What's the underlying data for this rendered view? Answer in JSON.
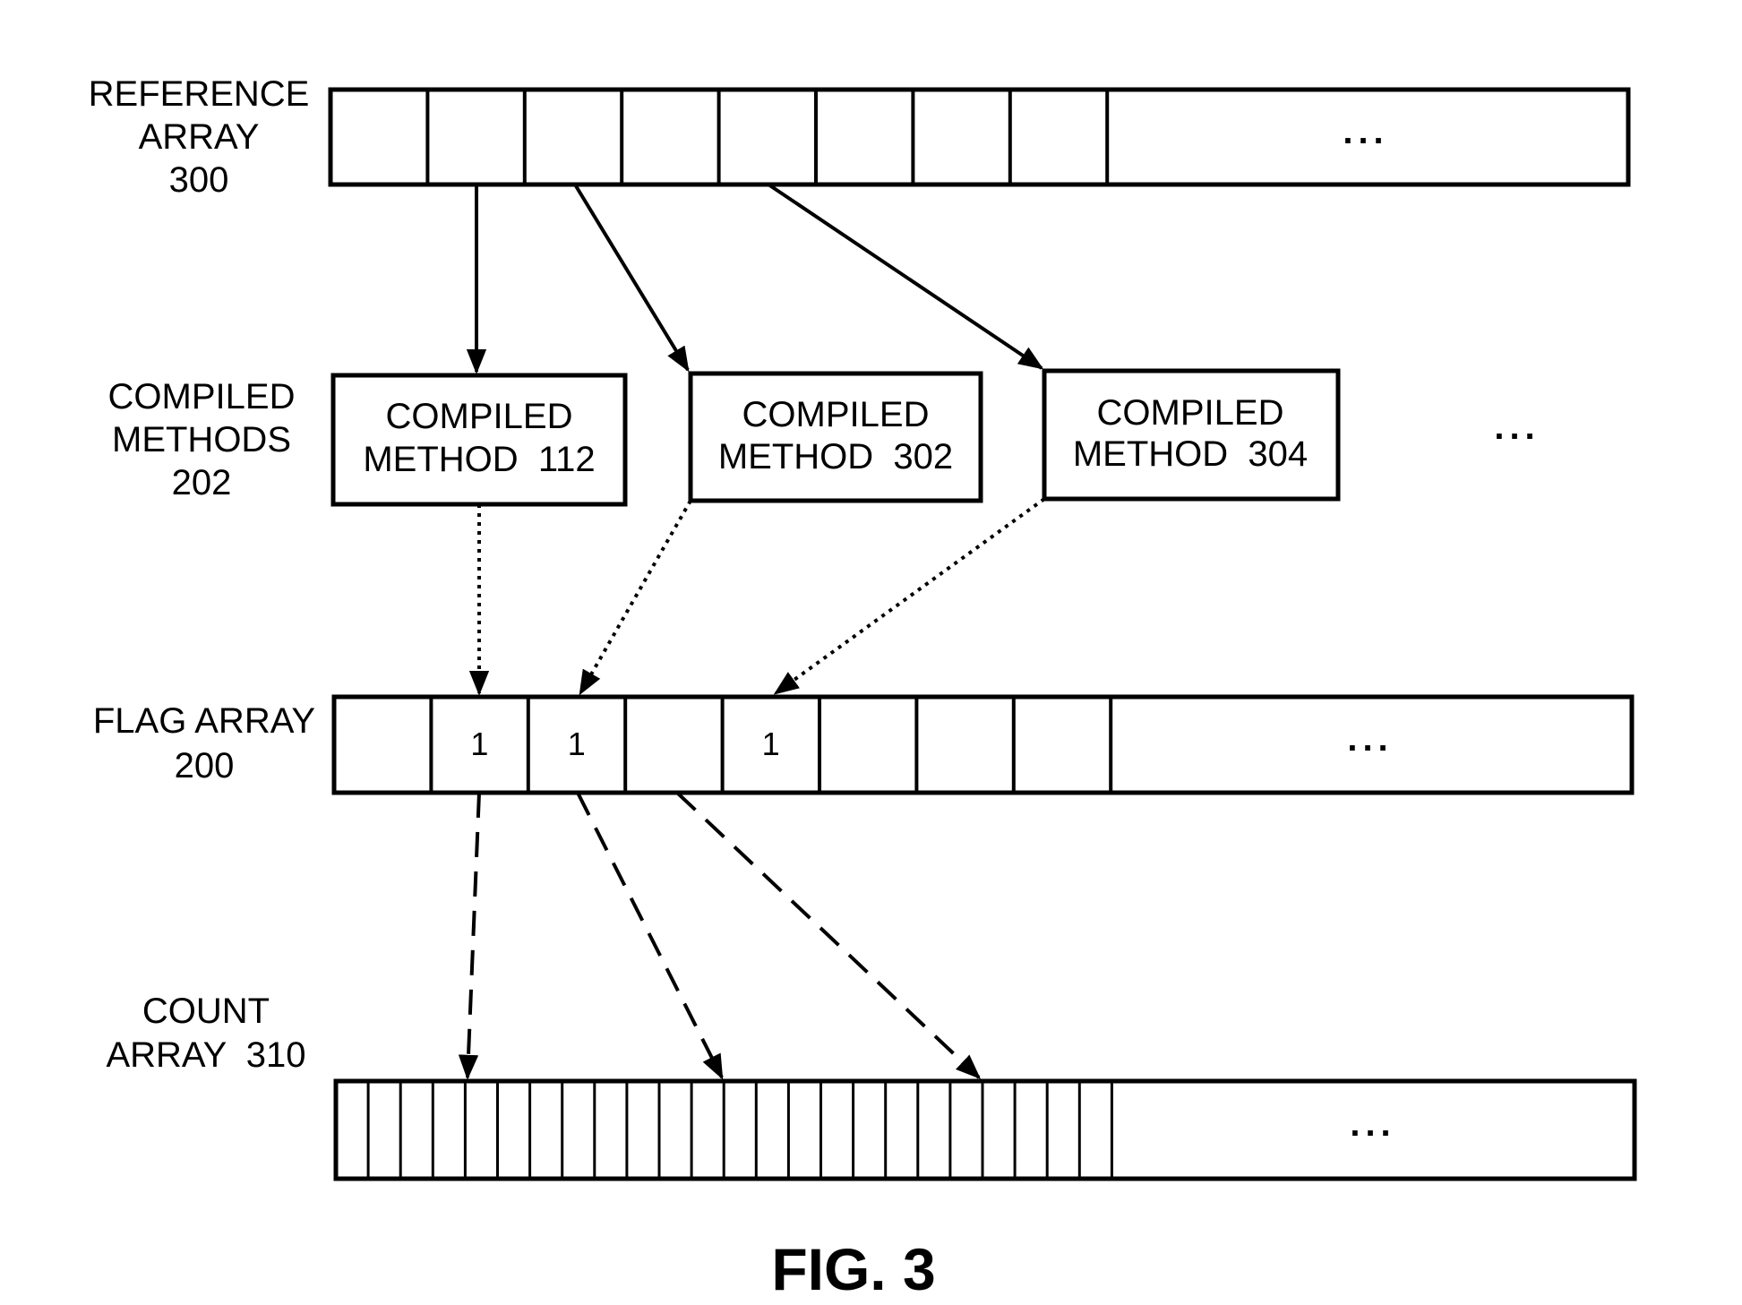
{
  "figure": {
    "title": "FIG. 3",
    "colors": {
      "ink": "#000000",
      "background": "#ffffff"
    }
  },
  "reference_array": {
    "label_lines": [
      "REFERENCE",
      "ARRAY",
      "300"
    ],
    "cell_count": 8,
    "ellipsis": "..."
  },
  "compiled_methods": {
    "label_lines": [
      "COMPILED",
      "METHODS",
      "202"
    ],
    "boxes": [
      {
        "line1": "COMPILED",
        "line2": "METHOD  112"
      },
      {
        "line1": "COMPILED",
        "line2": "METHOD  302"
      },
      {
        "line1": "COMPILED",
        "line2": "METHOD  304"
      }
    ],
    "ellipsis": "..."
  },
  "flag_array": {
    "label_lines": [
      "FLAG ARRAY",
      "200"
    ],
    "cells": [
      "",
      "1",
      "1",
      "",
      "1",
      "",
      "",
      ""
    ],
    "ellipsis": "..."
  },
  "count_array": {
    "label_lines": [
      "COUNT",
      "ARRAY  310"
    ],
    "cell_count": 24,
    "ellipsis": "..."
  },
  "connections": [
    {
      "from": "reference_array.cell.1",
      "to": "compiled_method_112",
      "style": "solid"
    },
    {
      "from": "reference_array.cell.2",
      "to": "compiled_method_302",
      "style": "solid"
    },
    {
      "from": "reference_array.cell.4",
      "to": "compiled_method_304",
      "style": "solid"
    },
    {
      "from": "compiled_method_112",
      "to": "flag_array.cell.1",
      "style": "dotted"
    },
    {
      "from": "compiled_method_302",
      "to": "flag_array.cell.2",
      "style": "dotted"
    },
    {
      "from": "compiled_method_304",
      "to": "flag_array.cell.4",
      "style": "dotted"
    },
    {
      "from": "flag_array.cell.1",
      "to": "count_array.cell.4",
      "style": "dashed"
    },
    {
      "from": "flag_array.cell.2",
      "to": "count_array.cell.12",
      "style": "dashed"
    },
    {
      "from": "flag_array.cell.3",
      "to": "count_array.cell.20",
      "style": "dashed"
    }
  ]
}
